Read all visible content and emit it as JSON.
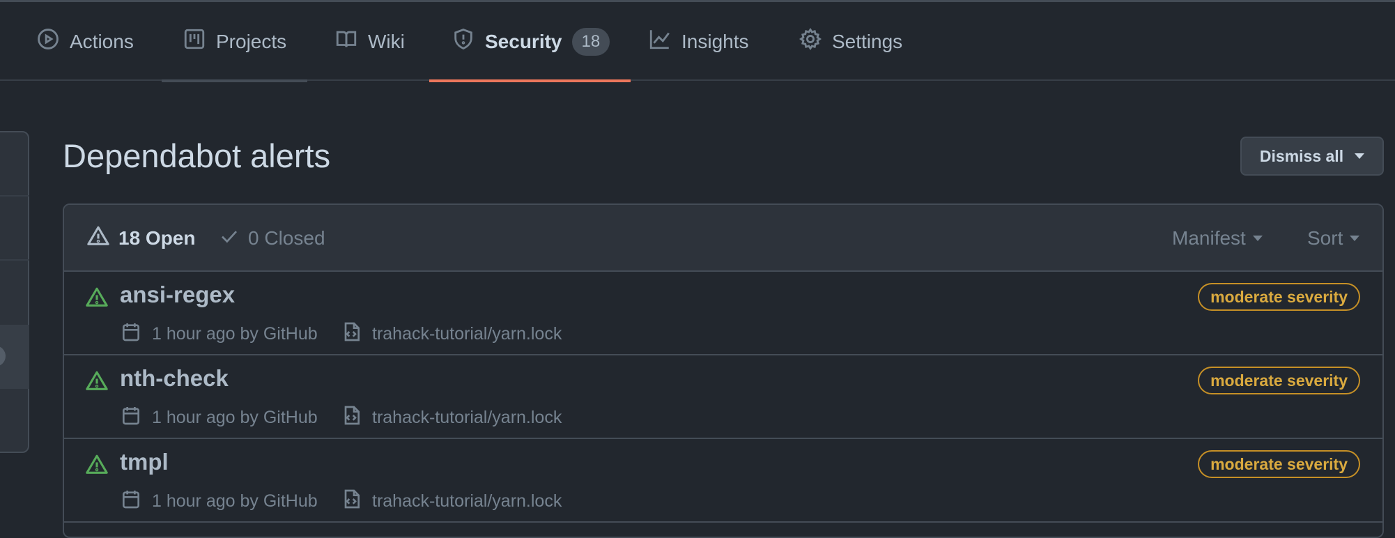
{
  "repo_nav": {
    "tabs": [
      {
        "label": "Actions",
        "icon": "play-circle-icon"
      },
      {
        "label": "Projects",
        "icon": "project-board-icon"
      },
      {
        "label": "Wiki",
        "icon": "book-icon"
      },
      {
        "label": "Security",
        "icon": "shield-icon",
        "counter": "18",
        "active": true
      },
      {
        "label": "Insights",
        "icon": "graph-icon"
      },
      {
        "label": "Settings",
        "icon": "gear-icon"
      }
    ]
  },
  "page": {
    "title": "Dependabot alerts",
    "dismiss_all_label": "Dismiss all"
  },
  "alerts_header": {
    "open_label": "18 Open",
    "closed_label": "0 Closed",
    "manifest_label": "Manifest",
    "sort_label": "Sort"
  },
  "alerts": [
    {
      "name": "ansi-regex",
      "time": "1 hour ago by GitHub",
      "file": "trahack-tutorial/yarn.lock",
      "severity": "moderate severity"
    },
    {
      "name": "nth-check",
      "time": "1 hour ago by GitHub",
      "file": "trahack-tutorial/yarn.lock",
      "severity": "moderate severity"
    },
    {
      "name": "tmpl",
      "time": "1 hour ago by GitHub",
      "file": "trahack-tutorial/yarn.lock",
      "severity": "moderate severity"
    }
  ],
  "colors": {
    "background": "#22272e",
    "active_tab_underline": "#ec775c",
    "alert_icon": "#57ab5a",
    "severity_moderate": "#daaa3f"
  }
}
